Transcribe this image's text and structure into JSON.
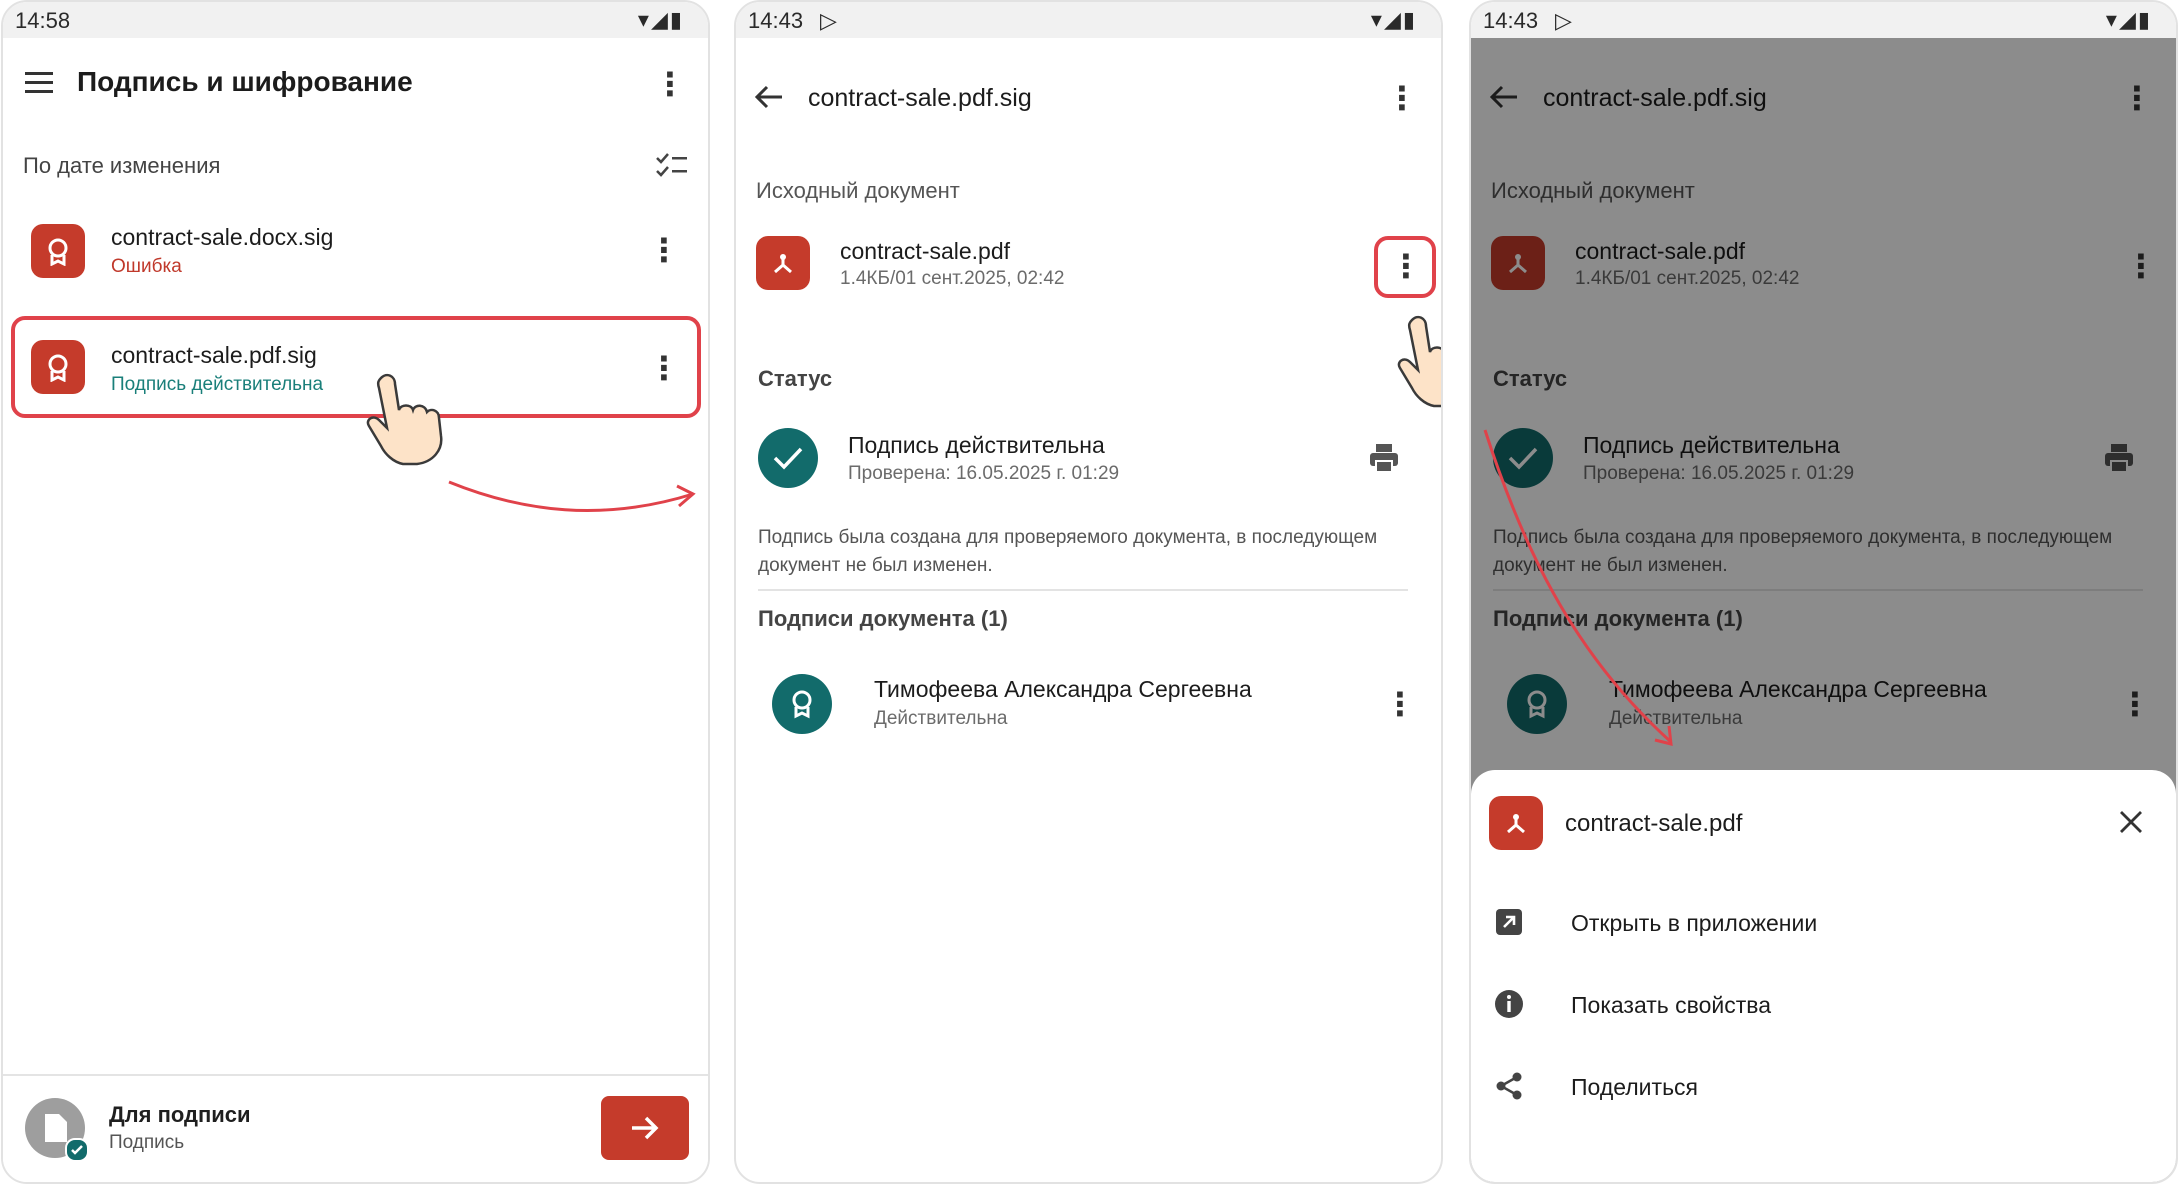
{
  "panel1": {
    "status_time": "14:58",
    "title": "Подпись и шифрование",
    "sort_label": "По дате изменения",
    "files": [
      {
        "name": "contract-sale.docx.sig",
        "status": "Ошибка"
      },
      {
        "name": "contract-sale.pdf.sig",
        "status": "Подпись действительна"
      }
    ],
    "bottom": {
      "title": "Для подписи",
      "subtitle": "Подпись"
    }
  },
  "panel2": {
    "status_time": "14:43",
    "title": "contract-sale.pdf.sig",
    "source_header": "Исходный документ",
    "doc_name": "contract-sale.pdf",
    "doc_meta": "1.4КБ/01 сент.2025, 02:42",
    "status_header": "Статус",
    "status_title": "Подпись действительна",
    "status_checked": "Проверена: 16.05.2025 г. 01:29",
    "description": "Подпись была создана для проверяемого документа, в последующем документ не был изменен.",
    "signatures_header": "Подписи документа (1)",
    "signer_name": "Тимофеева Александра Сергеевна",
    "signer_status": "Действительна"
  },
  "panel3": {
    "status_time": "14:43",
    "sheet_title": "contract-sale.pdf",
    "menu": [
      {
        "label": "Открыть в приложении",
        "icon": "open-external-icon"
      },
      {
        "label": "Показать свойства",
        "icon": "info-icon"
      },
      {
        "label": "Поделиться",
        "icon": "share-icon"
      }
    ]
  },
  "colors": {
    "accent_red": "#c53b2b",
    "accent_teal": "#126b6b",
    "highlight": "#e0424a",
    "valid_text": "#1a7f7a",
    "error_text": "#c0392b"
  }
}
